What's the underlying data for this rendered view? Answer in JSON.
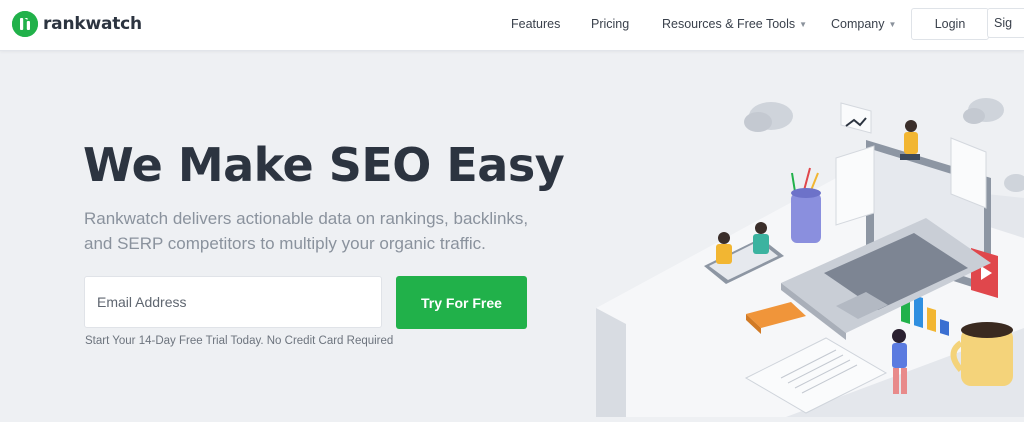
{
  "brand": {
    "name": "rankwatch",
    "accent": "#21b14a"
  },
  "nav": {
    "features": "Features",
    "pricing": "Pricing",
    "resources": "Resources & Free Tools",
    "company": "Company",
    "login": "Login",
    "signup": "Sig"
  },
  "hero": {
    "headline": "We Make SEO Easy",
    "subtext": "Rankwatch delivers actionable data on rankings, backlinks, and SERP competitors to multiply your organic traffic.",
    "email_placeholder": "Email Address",
    "cta": "Try For Free",
    "trial_note": "Start Your 14-Day Free Trial Today. No Credit Card Required"
  },
  "icons": {
    "logo": "rankwatch-logo-icon",
    "caret": "chevron-down-icon",
    "illustration": "seo-workspace-illustration"
  }
}
